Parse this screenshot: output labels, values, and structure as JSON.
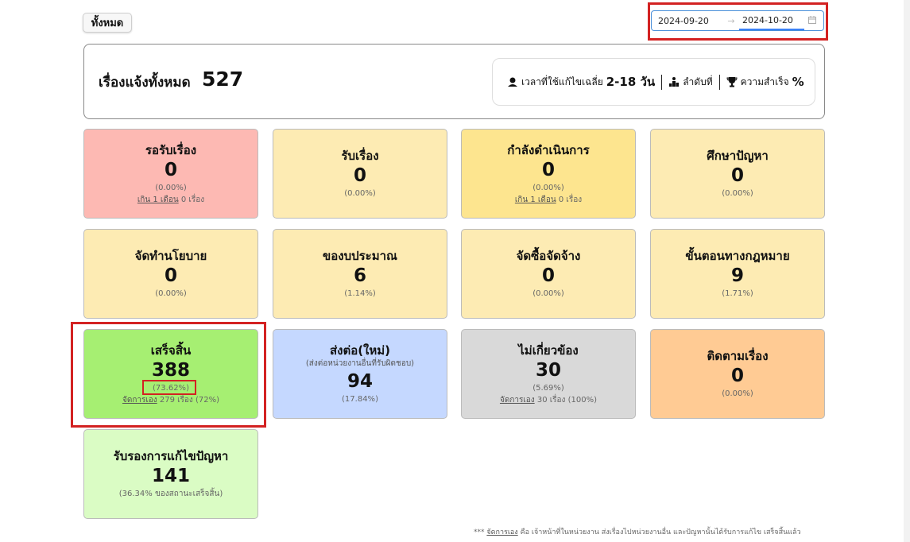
{
  "filter": {
    "label": "ทั้งหมด"
  },
  "date_range": {
    "start": "2024-09-20",
    "arrow": "→",
    "end": "2024-10-20"
  },
  "summary": {
    "label": "เรื่องแจ้งทั้งหมด",
    "total": "527",
    "avg_time_label": "เวลาที่ใช้แก้ไขเฉลี่ย",
    "avg_time_value": "2-18 วัน",
    "rank_label": "ลำดับที่",
    "success_label": "ความสำเร็จ",
    "success_value": "%"
  },
  "cards": [
    {
      "title": "รอรับเรื่อง",
      "count": "0",
      "percent": "(0.00%)",
      "extra_link": "เกิน 1 เดือน",
      "extra_text": " 0 เรื่อง",
      "color": "#fdb9b3"
    },
    {
      "title": "รับเรื่อง",
      "count": "0",
      "percent": "(0.00%)",
      "color": "#fdebb3"
    },
    {
      "title": "กำลังดำเนินการ",
      "count": "0",
      "percent": "(0.00%)",
      "extra_link": "เกิน 1 เดือน",
      "extra_text": " 0 เรื่อง",
      "color": "#fde58f"
    },
    {
      "title": "ศึกษาปัญหา",
      "count": "0",
      "percent": "(0.00%)",
      "color": "#fdebb3"
    },
    {
      "title": "จัดทำนโยบาย",
      "count": "0",
      "percent": "(0.00%)",
      "color": "#fdebb3"
    },
    {
      "title": "ของบประมาณ",
      "count": "6",
      "percent": "(1.14%)",
      "color": "#fdebb3"
    },
    {
      "title": "จัดซื้อจัดจ้าง",
      "count": "0",
      "percent": "(0.00%)",
      "color": "#fdebb3"
    },
    {
      "title": "ขั้นตอนทางกฎหมาย",
      "count": "9",
      "percent": "(1.71%)",
      "color": "#fdebb3"
    },
    {
      "title": "เสร็จสิ้น",
      "count": "388",
      "percent": "(73.62%)",
      "extra_link": "จัดการเอง",
      "extra_text": " 279 เรื่อง (72%)",
      "color": "#a6ef72"
    },
    {
      "title": "ส่งต่อ(ใหม่)",
      "subtitle": "(ส่งต่อหน่วยงานอื่นที่รับผิดชอบ)",
      "count": "94",
      "percent": "(17.84%)",
      "color": "#c5d8ff"
    },
    {
      "title": "ไม่เกี่ยวข้อง",
      "count": "30",
      "percent": "(5.69%)",
      "extra_link": "จัดการเอง",
      "extra_text": " 30 เรื่อง (100%)",
      "color": "#d9d9d9"
    },
    {
      "title": "ติดตามเรื่อง",
      "count": "0",
      "percent": "(0.00%)",
      "color": "#ffcb94"
    },
    {
      "title": "รับรองการแก้ไขปัญหา",
      "count": "141",
      "percent": "(36.34% ของสถานะเสร็จสิ้น)",
      "color": "#dafcc4"
    }
  ],
  "footnote": {
    "prefix": "*** ",
    "link": "จัดการเอง",
    "text": " คือ เจ้าหน้าที่ในหน่วยงาน ส่งเรื่องไปหน่วยงานอื่น และปัญหานั้นได้รับการแก้ไข เสร็จสิ้นแล้ว"
  }
}
